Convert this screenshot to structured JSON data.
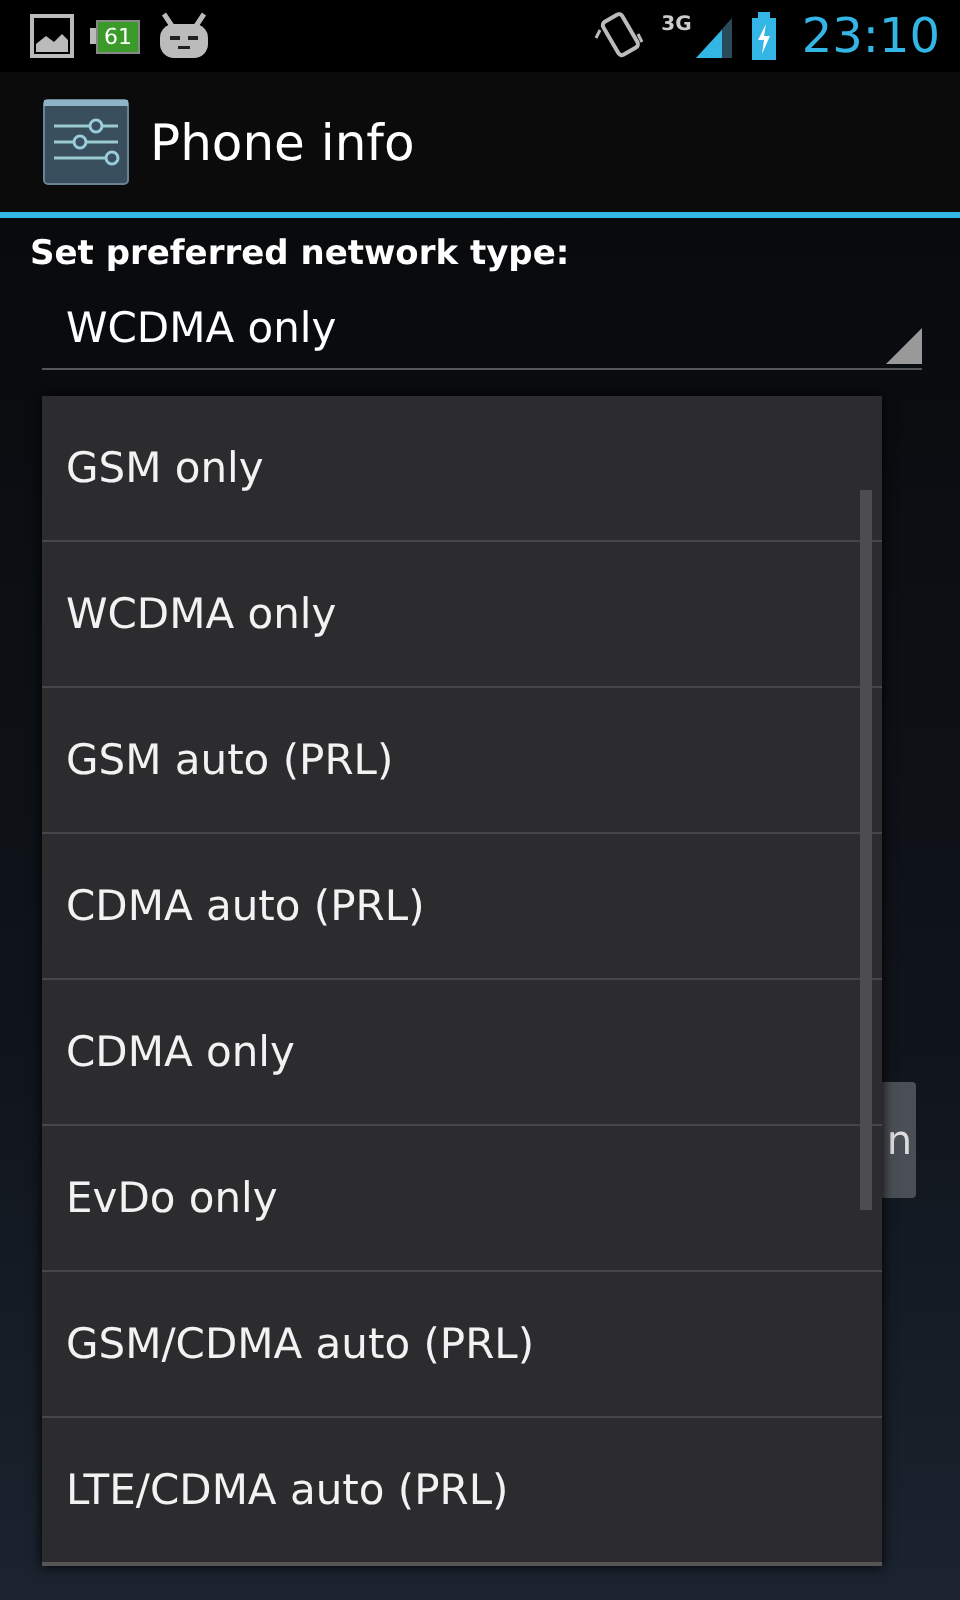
{
  "status_bar": {
    "battery_badge": "61",
    "network": "3G",
    "time": "23:10"
  },
  "header": {
    "title": "Phone info"
  },
  "content": {
    "label": "Set preferred network type:",
    "spinner_value": "WCDMA only",
    "hidden_button": "n"
  },
  "dropdown": {
    "items": [
      {
        "label": "GSM only"
      },
      {
        "label": "WCDMA only"
      },
      {
        "label": "GSM auto (PRL)"
      },
      {
        "label": "CDMA auto (PRL)"
      },
      {
        "label": "CDMA only"
      },
      {
        "label": "EvDo only"
      },
      {
        "label": "GSM/CDMA auto (PRL)"
      },
      {
        "label": "LTE/CDMA auto (PRL)"
      }
    ]
  }
}
